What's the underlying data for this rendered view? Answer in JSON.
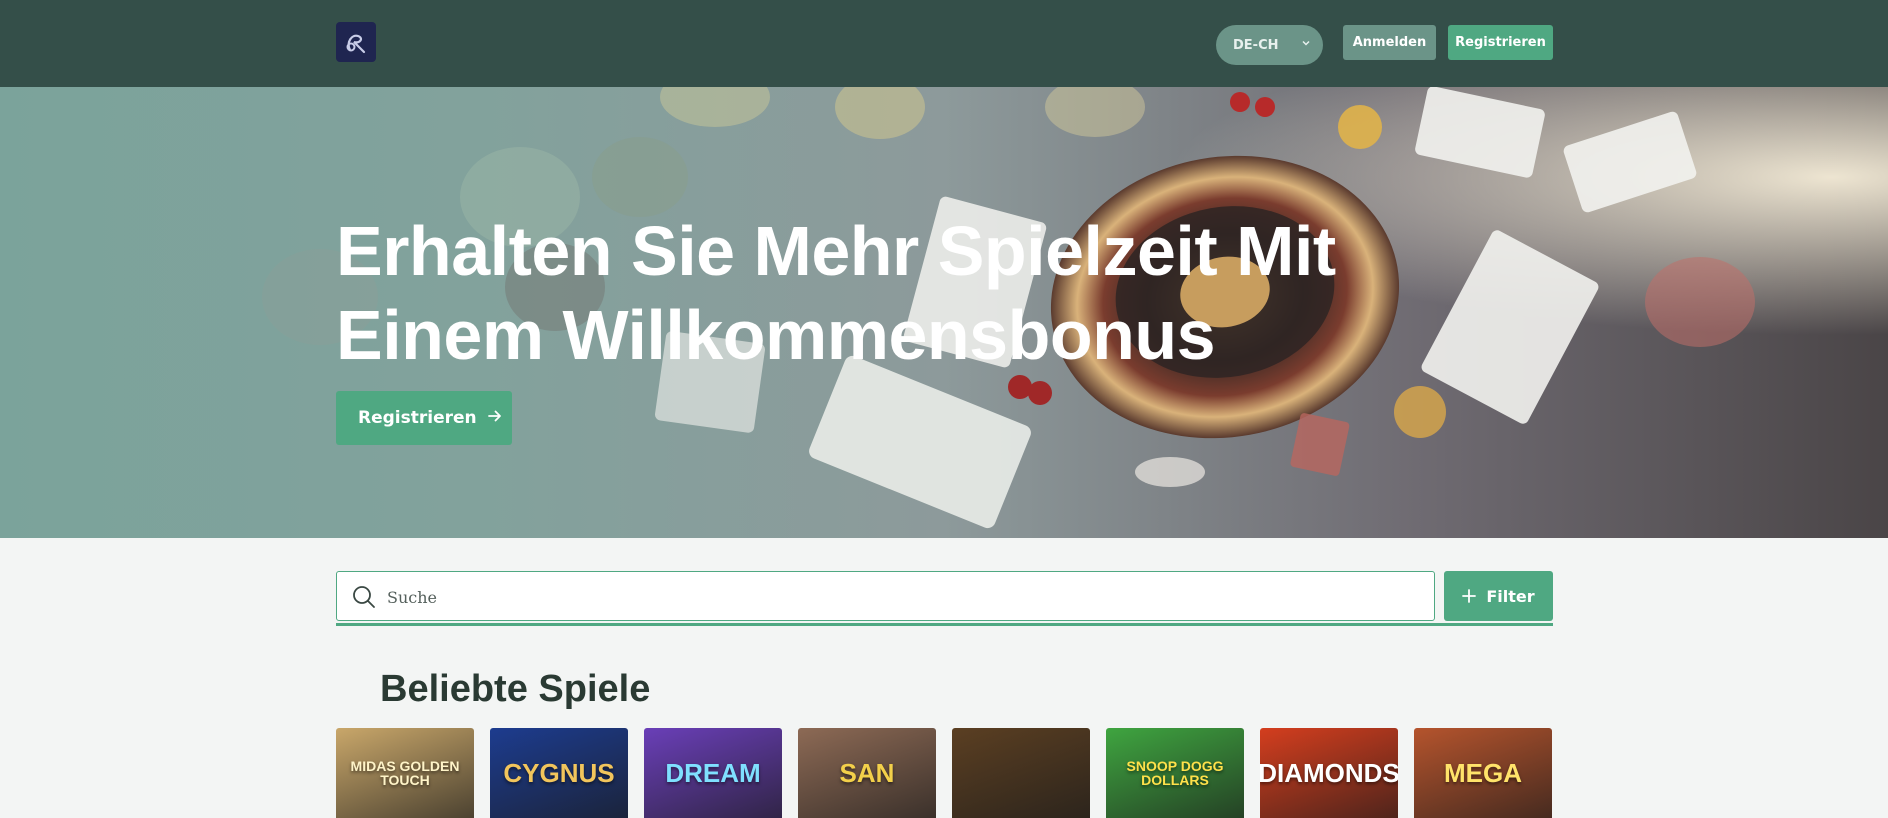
{
  "header": {
    "logo_icon": "brand-logo-icon",
    "language": "DE-CH",
    "login_label": "Anmelden",
    "register_label": "Registrieren"
  },
  "hero": {
    "title_line1": "Erhalten Sie Mehr Spielzeit Mit",
    "title_line2": "Einem Willkommensbonus",
    "cta_label": "Registrieren",
    "cta_icon": "arrow-right-icon"
  },
  "search": {
    "placeholder": "Suche",
    "value": "",
    "icon": "search-icon",
    "filter_label": "Filter",
    "filter_icon": "plus-icon"
  },
  "popular": {
    "title": "Beliebte Spiele",
    "games": [
      {
        "label": "MIDAS GOLDEN TOUCH",
        "bg": "#c9a76a",
        "fg": "#fff4c8"
      },
      {
        "label": "CYGNUS",
        "bg": "#1d3c8f",
        "fg": "#f2c55c"
      },
      {
        "label": "DREAM",
        "bg": "#6a3fb8",
        "fg": "#7fe0ff"
      },
      {
        "label": "SAN",
        "bg": "#8d6a55",
        "fg": "#f3d04a"
      },
      {
        "label": "",
        "bg": "#5b3f22",
        "fg": "#f0c070"
      },
      {
        "label": "SNOOP DOGG DOLLARS",
        "bg": "#3fa540",
        "fg": "#ffe14a"
      },
      {
        "label": "DIAMONDS",
        "bg": "#d43e1e",
        "fg": "#ffffff"
      },
      {
        "label": "MEGA",
        "bg": "#b5542d",
        "fg": "#ffe36a"
      }
    ]
  },
  "colors": {
    "header_bg": "#344f49",
    "accent_green": "#4fa882",
    "muted_green": "#6b9488",
    "page_bg": "#f3f5f4"
  }
}
